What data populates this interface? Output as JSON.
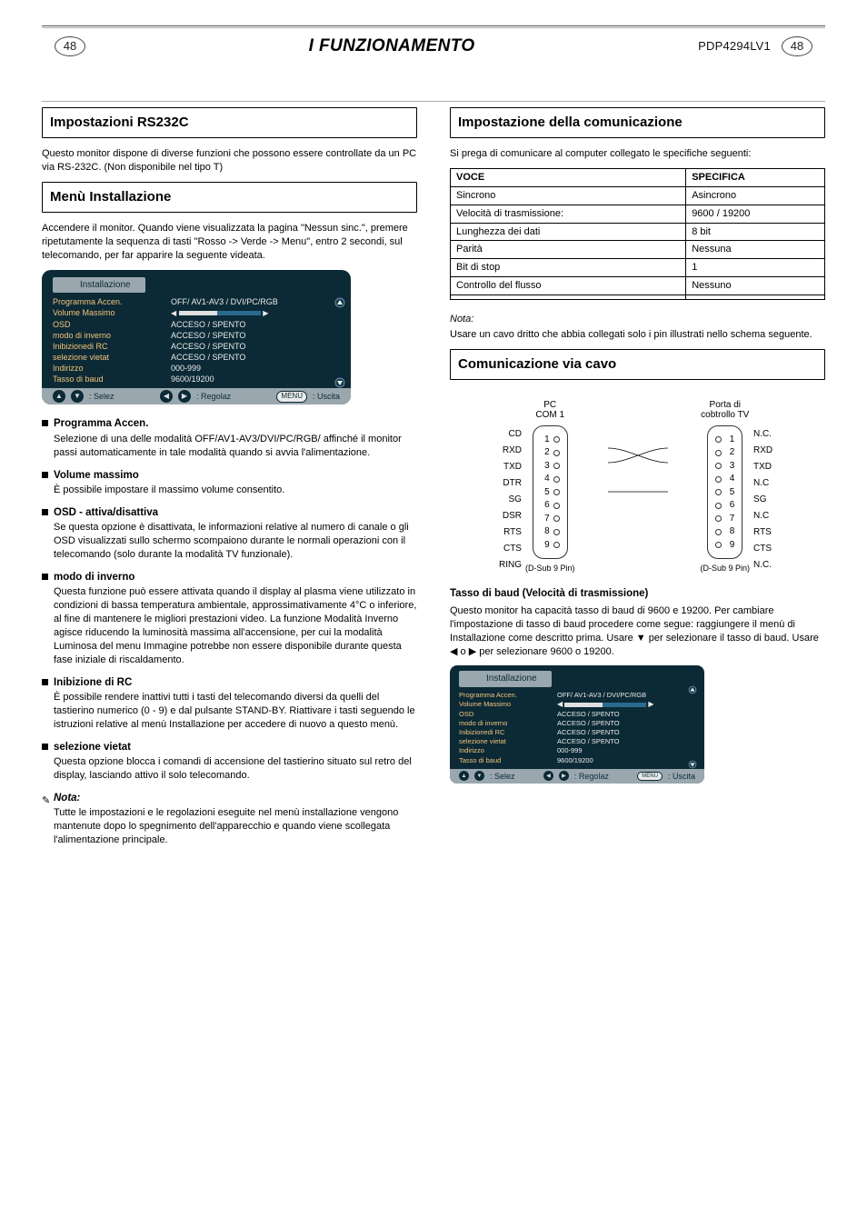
{
  "header": {
    "page_no_left": "48",
    "title": "FUNZIONAMENTO",
    "model": "PDP4294LV1",
    "page_no_right": "48"
  },
  "sections": {
    "rs232c": "Impostazioni RS232C",
    "install_menu": "Menù Installazione",
    "comm_spec": "Impostazione della comunicazione",
    "cable_wiring": "Comunicazione via cavo"
  },
  "rs232c_intro": "Questo monitor dispone di diverse funzioni che possono essere controllate da un PC via RS-232C. (Non disponibile nel tipo T)",
  "install_menu": {
    "intro": "Accendere il monitor. Quando viene visualizzata la pagina \"Nessun sinc.\", premere ripetutamente la sequenza di tasti \"Rosso -> Verde -> Menu\", entro 2 secondi, sul telecomando, per far apparire la seguente videata."
  },
  "osd": {
    "tab": "Installazione",
    "rows": [
      {
        "k": "Programma Accen.",
        "v": "OFF/ AV1-AV3 / DVI/PC/RGB"
      },
      {
        "k": "Volume Massimo",
        "v": "__slider__"
      },
      {
        "k": "OSD",
        "v": "ACCESO / SPENTO"
      },
      {
        "k": "modo di inverno",
        "v": "ACCESO / SPENTO"
      },
      {
        "k": "Inibizionedi RC",
        "v": "ACCESO / SPENTO"
      },
      {
        "k": "selezione vietat",
        "v": "ACCESO / SPENTO"
      },
      {
        "k": "Indirizzo",
        "v": "000-999"
      },
      {
        "k": "Tasso di baud",
        "v": "9600/19200"
      }
    ],
    "footer": {
      "sel": ": Selez",
      "reg": ": Regolaz",
      "menu_label": "MENU",
      "exit": ": Uscita"
    }
  },
  "bullets": [
    {
      "hd": "Programma Accen.",
      "bd": "Selezione di una delle modalità OFF/AV1-AV3/DVI/PC/RGB/ affinché il monitor passi automaticamente in tale modalità quando si avvia l'alimentazione."
    },
    {
      "hd": "Volume massimo",
      "bd": "È possibile impostare il massimo volume consentito."
    },
    {
      "hd": "OSD - attiva/disattiva",
      "bd": "Se questa opzione è disattivata, le informazioni relative al numero di canale o gli OSD visualizzati sullo schermo scompaiono durante le normali operazioni con il telecomando (solo durante la modalità TV funzionale)."
    },
    {
      "hd": "modo di inverno",
      "bd": "Questa funzione può essere attivata quando il display al plasma viene utilizzato in condizioni di bassa temperatura ambientale, approssimativamente 4°C o inferiore, al fine di mantenere le migliori prestazioni video. La funzione Modalità Inverno agisce riducendo la luminosità massima all'accensione, per cui la modalità Luminosa del menu Immagine potrebbe non essere disponibile durante questa fase iniziale di riscaldamento."
    },
    {
      "hd": "Inibizione di RC",
      "bd": "È possibile rendere inattivi tutti i tasti del telecomando diversi da quelli del tastierino numerico (0 - 9) e dal pulsante STAND-BY. Riattivare i tasti seguendo le istruzioni relative al menù Installazione per accedere di nuovo a questo menù."
    },
    {
      "hd": "selezione vietat",
      "bd": "Questa opzione blocca i comandi di accensione del tastierino situato sul retro del display, lasciando attivo il solo telecomando."
    }
  ],
  "note": {
    "icon": "✎",
    "hd": "Nota:",
    "bd": "Tutte le impostazioni e le regolazioni eseguite nel menù installazione vengono mantenute dopo lo spegnimento dell'apparecchio e quando viene scollegata l'alimentazione principale."
  },
  "comm_spec_intro": "Si prega di comunicare al computer collegato le specifiche seguenti:",
  "spec_table": {
    "headers": [
      "VOCE",
      "SPECIFICA"
    ],
    "rows": [
      [
        "Sincrono",
        "Asincrono"
      ],
      [
        "Velocità di trasmissione:",
        "9600 / 19200"
      ],
      [
        "Lunghezza dei dati",
        "8 bit"
      ],
      [
        "Parità",
        "Nessuna"
      ],
      [
        "Bit di stop",
        "1"
      ],
      [
        "Controllo del flusso",
        "Nessuno"
      ],
      [
        "",
        ""
      ]
    ]
  },
  "spec_note": {
    "title": "Nota:",
    "body": "Usare un cavo dritto che abbia collegati solo i pin illustrati nello schema seguente."
  },
  "cable": {
    "left_title1": "PC",
    "left_title2": "COM 1",
    "right_title1": "Porta di",
    "right_title2": "cobtrollo TV",
    "left_pins": [
      {
        "n": "1",
        "l": "CD"
      },
      {
        "n": "2",
        "l": "RXD"
      },
      {
        "n": "3",
        "l": "TXD"
      },
      {
        "n": "4",
        "l": "DTR"
      },
      {
        "n": "5",
        "l": "SG"
      },
      {
        "n": "6",
        "l": "DSR"
      },
      {
        "n": "7",
        "l": "RTS"
      },
      {
        "n": "8",
        "l": "CTS"
      },
      {
        "n": "9",
        "l": "RING"
      }
    ],
    "right_pins": [
      {
        "n": "1",
        "l": "N.C."
      },
      {
        "n": "2",
        "l": "RXD"
      },
      {
        "n": "3",
        "l": "TXD"
      },
      {
        "n": "4",
        "l": "N.C"
      },
      {
        "n": "5",
        "l": "SG"
      },
      {
        "n": "6",
        "l": "N.C"
      },
      {
        "n": "7",
        "l": "RTS"
      },
      {
        "n": "8",
        "l": "CTS"
      },
      {
        "n": "9",
        "l": "N.C."
      }
    ],
    "dsub": "(D-Sub   9 Pin)"
  },
  "baud": {
    "hd": "Tasso di baud (Velocità di trasmissione)",
    "body": "Questo monitor ha capacità tasso di baud di 9600 e 19200. Per cambiare l'impostazione di tasso di baud procedere come segue: raggiungere il menù di Installazione come descritto prima. Usare ▼ per selezionare il tasso di baud. Usare ◀ o ▶ per selezionare 9600 o 19200."
  }
}
